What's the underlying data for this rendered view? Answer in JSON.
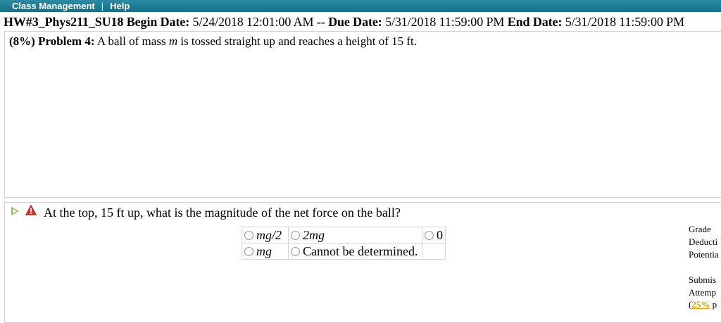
{
  "nav": {
    "class_management": "Class Management",
    "separator": "|",
    "help": "Help"
  },
  "header": {
    "assignment": "HW#3_Phys211_SU18",
    "begin_label": "Begin Date:",
    "begin_value": "5/24/2018 12:01:00 AM",
    "sep": "--",
    "due_label": "Due Date:",
    "due_value": "5/31/2018 11:59:00 PM",
    "end_label": "End Date:",
    "end_value": "5/31/2018 11:59:00 PM"
  },
  "problem": {
    "weight": "(8%)",
    "label": "Problem 4:",
    "text_before": "A ball of mass",
    "mass_var": "m",
    "text_after": "is tossed straight up and reaches a height of 15 ft."
  },
  "question": {
    "text": "At the top, 15 ft up, what is the magnitude of the net force on the ball?",
    "options": [
      [
        "mg/2",
        "2mg",
        "0"
      ],
      [
        "mg",
        "Cannot be determined.",
        ""
      ]
    ]
  },
  "side": {
    "grade": "Grade",
    "deduction": "Deducti",
    "potential": "Potentia",
    "submissions": "Submis",
    "attempts": "Attemp",
    "pct_open": "(",
    "pct": "25%",
    "pct_after": " p"
  },
  "colors": {
    "nav_bar": "#137089",
    "arrow": "#8cc04a",
    "warning": "#d9332b",
    "percent": "#e8a000"
  }
}
